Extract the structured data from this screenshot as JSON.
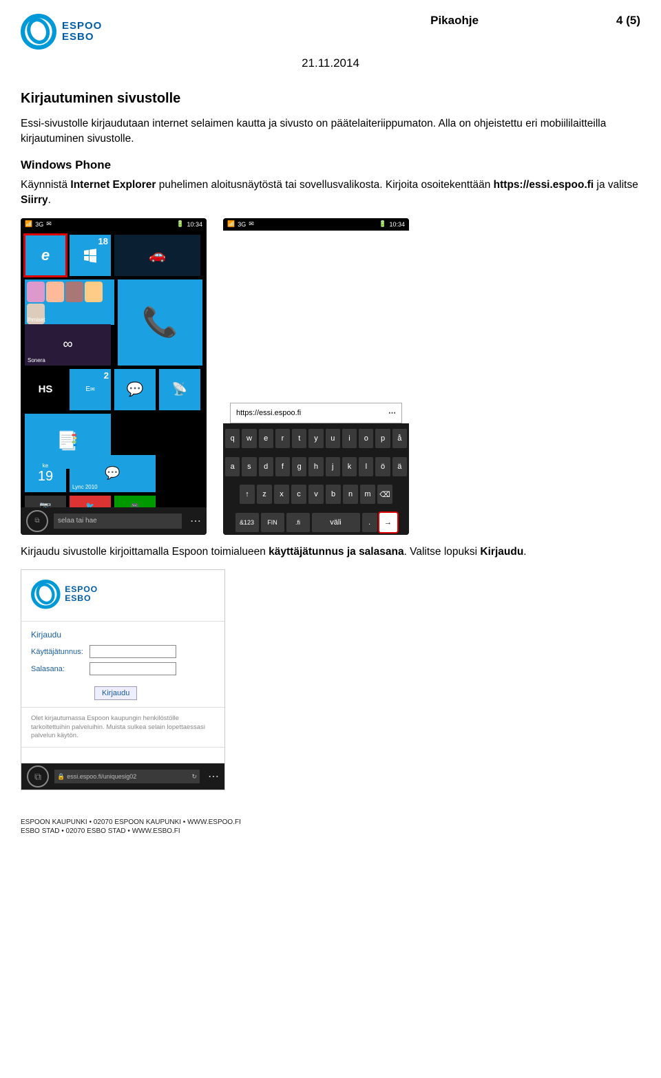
{
  "header": {
    "doc_type": "Pikaohje",
    "page_no": "4 (5)",
    "date": "21.11.2014"
  },
  "logo": {
    "line1": "ESPOO",
    "line2": "ESBO"
  },
  "h2": "Kirjautuminen sivustolle",
  "p1a": "Essi-sivustolle kirjaudutaan internet selaimen kautta ja sivusto on päätelaiteriippumaton. Alla on ohjeistettu eri mobiililaitteilla kirjautuminen sivustolle.",
  "h3": "Windows Phone",
  "p2": {
    "a": "Käynnistä ",
    "b": "Internet Explorer",
    "c": " puhelimen aloitusnäytöstä tai sovellusvalikosta. Kirjoita osoitekenttään ",
    "d": "https://essi.espoo.fi",
    "e": " ja valitse ",
    "f": "Siirry",
    "g": "."
  },
  "phone1": {
    "time": "10:34",
    "sig": "3G",
    "store_badge": "18",
    "people": "Ihmiset",
    "sonera": "Sonera",
    "hs": "HS",
    "mail_badge": "2",
    "date_day": "ke",
    "date_num": "19",
    "lync": "Lync 2010",
    "addr_placeholder": "selaa tai hae"
  },
  "phone2": {
    "time": "10:34",
    "sig": "3G",
    "url": "https://essi.espoo.fi",
    "row1": [
      "q",
      "w",
      "e",
      "r",
      "t",
      "y",
      "u",
      "i",
      "o",
      "p",
      "å"
    ],
    "row2": [
      "a",
      "s",
      "d",
      "f",
      "g",
      "h",
      "j",
      "k",
      "l",
      "ö",
      "ä"
    ],
    "row3": [
      "↑",
      "z",
      "x",
      "c",
      "v",
      "b",
      "n",
      "m",
      "⌫"
    ],
    "row4": [
      "&123",
      "FIN",
      ".fi",
      "väli",
      ".",
      "→"
    ]
  },
  "p3": {
    "a": "Kirjaudu sivustolle kirjoittamalla Espoon toimialueen ",
    "b": "käyttäjätunnus ja salasana",
    "c": ". Valitse lopuksi ",
    "d": "Kirjaudu",
    "e": "."
  },
  "login": {
    "heading": "Kirjaudu",
    "user": "Käyttäjätunnus:",
    "pass": "Salasana:",
    "btn": "Kirjaudu",
    "note": "Olet kirjautumassa Espoon kaupungin henkilöstölle tarkoitettuihin palveluihin. Muista sulkea selain lopettaessasi palvelun käytön.",
    "navurl": "essi.espoo.fi/uniquesig02"
  },
  "footer": {
    "l1": "ESPOON KAUPUNKI • 02070 ESPOON KAUPUNKI • WWW.ESPOO.FI",
    "l2": "ESBO STAD • 02070 ESBO STAD • WWW.ESBO.FI"
  }
}
